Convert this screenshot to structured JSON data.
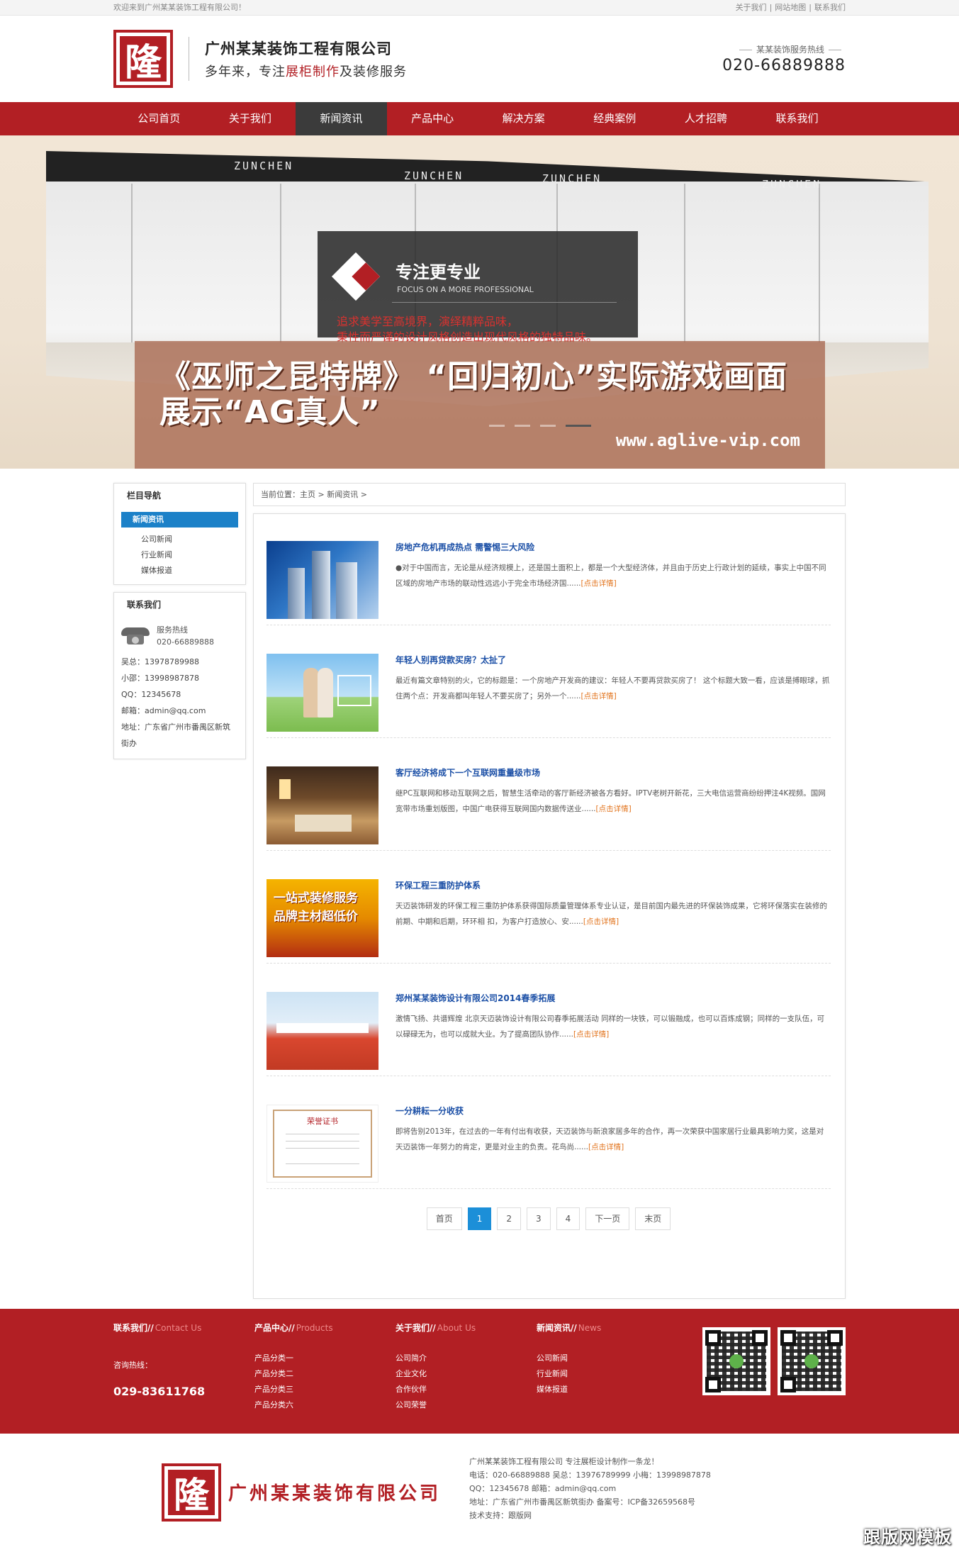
{
  "topbar": {
    "welcome": "欢迎来到广州某某装饰工程有限公司！",
    "links": [
      "关于我们",
      "网站地图",
      "联系我们"
    ]
  },
  "header": {
    "seal_char": "隆",
    "company": "广州某某装饰工程有限公司",
    "slogan_a": "多年来，专注",
    "slogan_hl": "展柜制作",
    "slogan_b": "及装修服务",
    "hotline_label": "某某装饰服务热线",
    "hotline_number": "020-66889888"
  },
  "nav": {
    "items": [
      "公司首页",
      "关于我们",
      "新闻资讯",
      "产品中心",
      "解决方案",
      "经典案例",
      "人才招聘",
      "联系我们"
    ],
    "active_index": 2
  },
  "banner": {
    "brand": "ZUNCHEN",
    "focus_cn": "专注更专业",
    "focus_en": "FOCUS ON A MORE PROFESSIONAL",
    "red_line1": "追求美学至高境界，演绎精粹品味，",
    "red_line2": "秉性而严谨的设计风格创造出现代风格的独特品味。",
    "overlay_line1": "《巫师之昆特牌》 “回归初心”实际游戏画面",
    "overlay_line2": "展示“AG真人”",
    "overlay_url": "www.aglive-vip.com"
  },
  "sidebar": {
    "nav_title": "栏目导航",
    "category": "新闻资讯",
    "subs": [
      "公司新闻",
      "行业新闻",
      "媒体报道"
    ],
    "contact_title": "联系我们",
    "phone_label": "服务热线",
    "phone_number": "020-66889888",
    "lines": [
      "吴总：13978789988",
      "小邵：13998987878",
      "QQ：12345678",
      "邮箱：admin@qq.com",
      "地址：广东省广州市番禺区新筑",
      "街办"
    ]
  },
  "breadcrumb": "当前位置：主页 > 新闻资讯 >",
  "news": [
    {
      "title": "房地产危机再成热点 需警惕三大风险",
      "desc": "●对于中国而言，无论是从经济规模上，还是国土面积上，都是一个大型经济体，并且由于历史上行政计划的延续，事实上中国不同区域的房地产市场的联动性远远小于完全市场经济国......",
      "more": "[点击详情]",
      "thumb": "buildings"
    },
    {
      "title": "年轻人别再贷款买房？太扯了",
      "desc": "最近有篇文章特别的火，它的标题是：一个房地产开发商的建议：年轻人不要再贷款买房了！ 这个标题大致一看，应该是搏眼球，抓住两个点：开发商都叫年轻人不要买房了；另外一个......",
      "more": "[点击详情]",
      "thumb": "couple"
    },
    {
      "title": "客厅经济将成下一个互联网重量级市场",
      "desc": "继PC互联网和移动互联网之后，智慧生活牵动的客厅新经济被各方看好。IPTV老树开新花，三大电信运营商纷纷押注4K视频。国网宽带市场重划版图，中国广电获得互联网国内数据传送业......",
      "more": "[点击详情]",
      "thumb": "livingroom"
    },
    {
      "title": "环保工程三重防护体系",
      "desc": "天迈装饰研发的环保工程三重防护体系获得国际质量管理体系专业认证，是目前国内最先进的环保装饰成果，它将环保落实在装修的前期、中期和后期，环环相 扣，为客户打造放心、安......",
      "more": "[点击详情]",
      "thumb": "ad",
      "thumb_text": "一站式装修服务 品牌主材超低价"
    },
    {
      "title": "郑州某某装饰设计有限公司2014春季拓展",
      "desc": "激情飞扬、共谱辉煌 北京天迈装饰设计有限公司春季拓展活动 同样的一块铁，可以锻融成，也可以百炼成钢；同样的一支队伍，可以碌碌无为，也可以成就大业。为了提高团队协作......",
      "more": "[点击详情]",
      "thumb": "team"
    },
    {
      "title": "一分耕耘一分收获",
      "desc": "即将告别2013年，在过去的一年有付出有收获，天迈装饰与新浪家居多年的合作，再一次荣获中国家居行业最具影响力奖，这是对天迈装饰一年努力的肯定，更是对业主的负责。花鸟尚......",
      "more": "[点击详情]",
      "thumb": "certificate",
      "thumb_text": "荣誉证书"
    }
  ],
  "pager": {
    "first": "首页",
    "pages": [
      "1",
      "2",
      "3",
      "4"
    ],
    "current": "1",
    "next": "下一页",
    "last": "末页"
  },
  "footer": {
    "cols": [
      {
        "title": "联系我们//",
        "en": "Contact Us",
        "hotline_label": "咨询热线：",
        "tel": "029-83611768"
      },
      {
        "title": "产品中心//",
        "en": "Products",
        "items": [
          "产品分类一",
          "产品分类二",
          "产品分类三",
          "产品分类六"
        ]
      },
      {
        "title": "关于我们//",
        "en": "About Us",
        "items": [
          "公司简介",
          "企业文化",
          "合作伙伴",
          "公司荣誉"
        ]
      },
      {
        "title": "新闻资讯//",
        "en": "News",
        "items": [
          "公司新闻",
          "行业新闻",
          "媒体报道"
        ]
      }
    ]
  },
  "bottom": {
    "seal_char": "隆",
    "company_logo_text": "广州某某装饰有限公司",
    "info": [
      "广州某某装饰工程有限公司    专注展柜设计制作一条龙！",
      "电话：020-66889888    吴总：13976789999    小梅：13998987878",
      "QQ：12345678    邮箱：admin@qq.com",
      "地址：广东省广州市番禺区新筑街办    备案号：ICP备32659568号",
      "技术支持：跟版网"
    ],
    "watermark": "跟版网模板"
  },
  "colors": {
    "brand_red": "#b21f24",
    "nav_active": "#3b3b3b",
    "link_blue": "#1b4fa6",
    "more_orange": "#e2731c",
    "pager_blue": "#1c8fd8"
  }
}
